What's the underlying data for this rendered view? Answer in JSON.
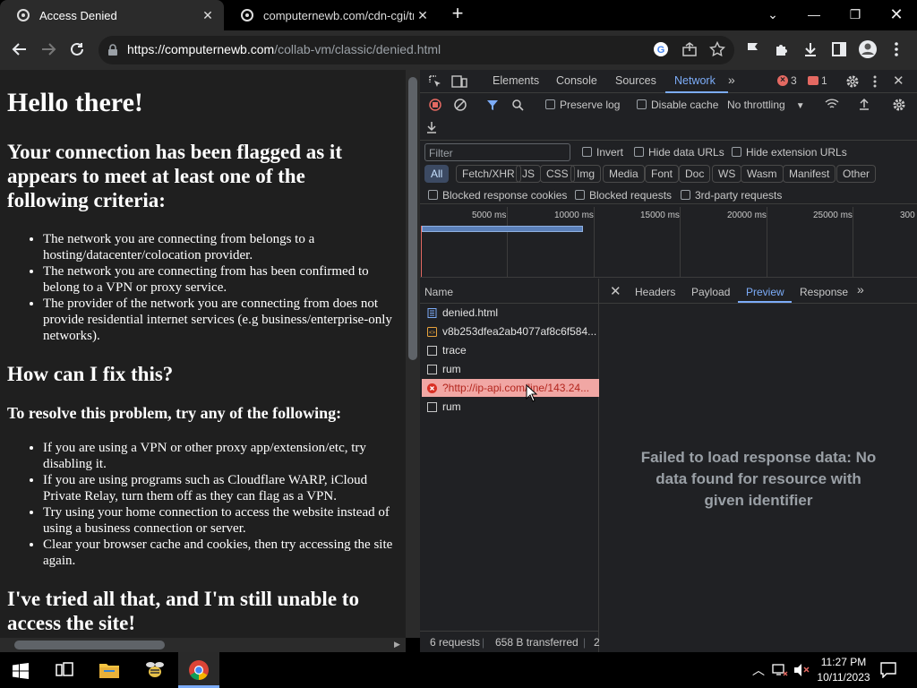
{
  "browser": {
    "tabs": [
      {
        "title": "Access Denied",
        "active": true
      },
      {
        "title": "computernewb.com/cdn-cgi/tra",
        "active": false
      }
    ],
    "url": {
      "host": "https://computernewb.com",
      "path": "/collab-vm/classic/denied.html"
    }
  },
  "page": {
    "h1": "Hello there!",
    "h2_flag": [
      "Your connection has been flagged as it",
      "appears to meet at least one of the",
      "following criteria:"
    ],
    "criteria": [
      "The network you are connecting from belongs to a hosting/datacenter/colocation provider.",
      "The network you are connecting from has been confirmed to belong to a VPN or proxy service.",
      "The provider of the network you are connecting from does not provide residential internet services (e.g business/enterprise-only networks)."
    ],
    "h2_fix": "How can I fix this?",
    "h3_resolve": "To resolve this problem, try any of the following:",
    "fixes": [
      "If you are using a VPN or other proxy app/extension/etc, try disabling it.",
      "If you are using programs such as Cloudflare WARP, iCloud Private Relay, turn them off as they can flag as a VPN.",
      "Try using your home connection to access the website instead of using a business connection or server.",
      "Clear your browser cache and cookies, then try accessing the site again."
    ],
    "h2_tried": [
      "I've tried all that, and I'm still unable to",
      "access the site!"
    ]
  },
  "devtools": {
    "tabs": [
      "Elements",
      "Console",
      "Sources",
      "Network"
    ],
    "active_tab": "Network",
    "errors": "3",
    "issues": "1",
    "preserve_log": "Preserve log",
    "disable_cache": "Disable cache",
    "throttling": "No throttling",
    "filter_placeholder": "Filter",
    "invert": "Invert",
    "hide_data_urls": "Hide data URLs",
    "hide_extension_urls": "Hide extension URLs",
    "type_filters": [
      "All",
      "Fetch/XHR",
      "JS",
      "CSS",
      "Img",
      "Media",
      "Font",
      "Doc",
      "WS",
      "Wasm",
      "Manifest",
      "Other"
    ],
    "blocked_response_cookies": "Blocked response cookies",
    "blocked_requests": "Blocked requests",
    "third_party": "3rd-party requests",
    "timeline_ticks": [
      "5000 ms",
      "10000 ms",
      "15000 ms",
      "20000 ms",
      "25000 ms",
      "300"
    ],
    "name_header": "Name",
    "detail_tabs": [
      "Headers",
      "Payload",
      "Preview",
      "Response"
    ],
    "active_detail_tab": "Preview",
    "requests": [
      {
        "name": "denied.html",
        "icon": "document-icon",
        "error": false
      },
      {
        "name": "v8b253dfea2ab4077af8c6f584...",
        "icon": "script-icon",
        "error": false
      },
      {
        "name": "trace",
        "icon": "file-icon",
        "error": false
      },
      {
        "name": "rum",
        "icon": "file-icon",
        "error": false
      },
      {
        "name": "?http://ip-api.com/line/143.24...",
        "icon": "error-icon",
        "error": true
      },
      {
        "name": "rum",
        "icon": "file-icon",
        "error": false
      }
    ],
    "preview_message": [
      "Failed to load response data: No",
      "data found for resource with",
      "given identifier"
    ],
    "status": {
      "requests": "6 requests",
      "transferred": "658 B transferred",
      "extra": "2"
    }
  },
  "taskbar": {
    "time": "11:27 PM",
    "date": "10/11/2023"
  },
  "colors": {
    "accent": "#7cacf8",
    "error": "#e46962",
    "error_row": "#f1a7a4"
  }
}
